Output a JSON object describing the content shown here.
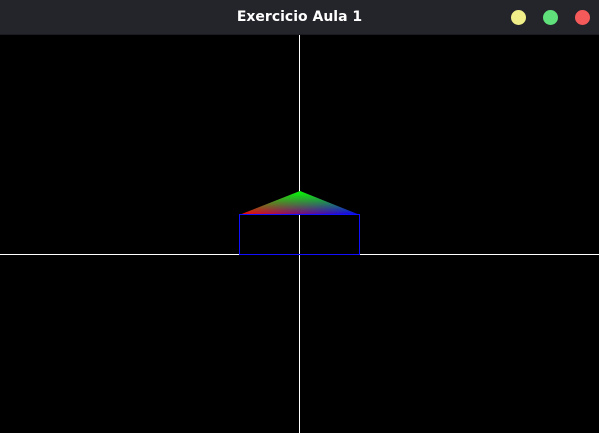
{
  "window": {
    "title": "Exercicio Aula 1",
    "controls": [
      {
        "name": "minimize",
        "color": "#f0ee88"
      },
      {
        "name": "maximize",
        "color": "#5fe07a"
      },
      {
        "name": "close",
        "color": "#f55a5a"
      }
    ]
  },
  "scene": {
    "background": "#000000",
    "axis_color": "#ffffff",
    "rectangle_outline_color": "#1010ff",
    "triangle_vertex_colors": {
      "left": "#ff0000",
      "top": "#00ff00",
      "right": "#0000ff"
    }
  }
}
